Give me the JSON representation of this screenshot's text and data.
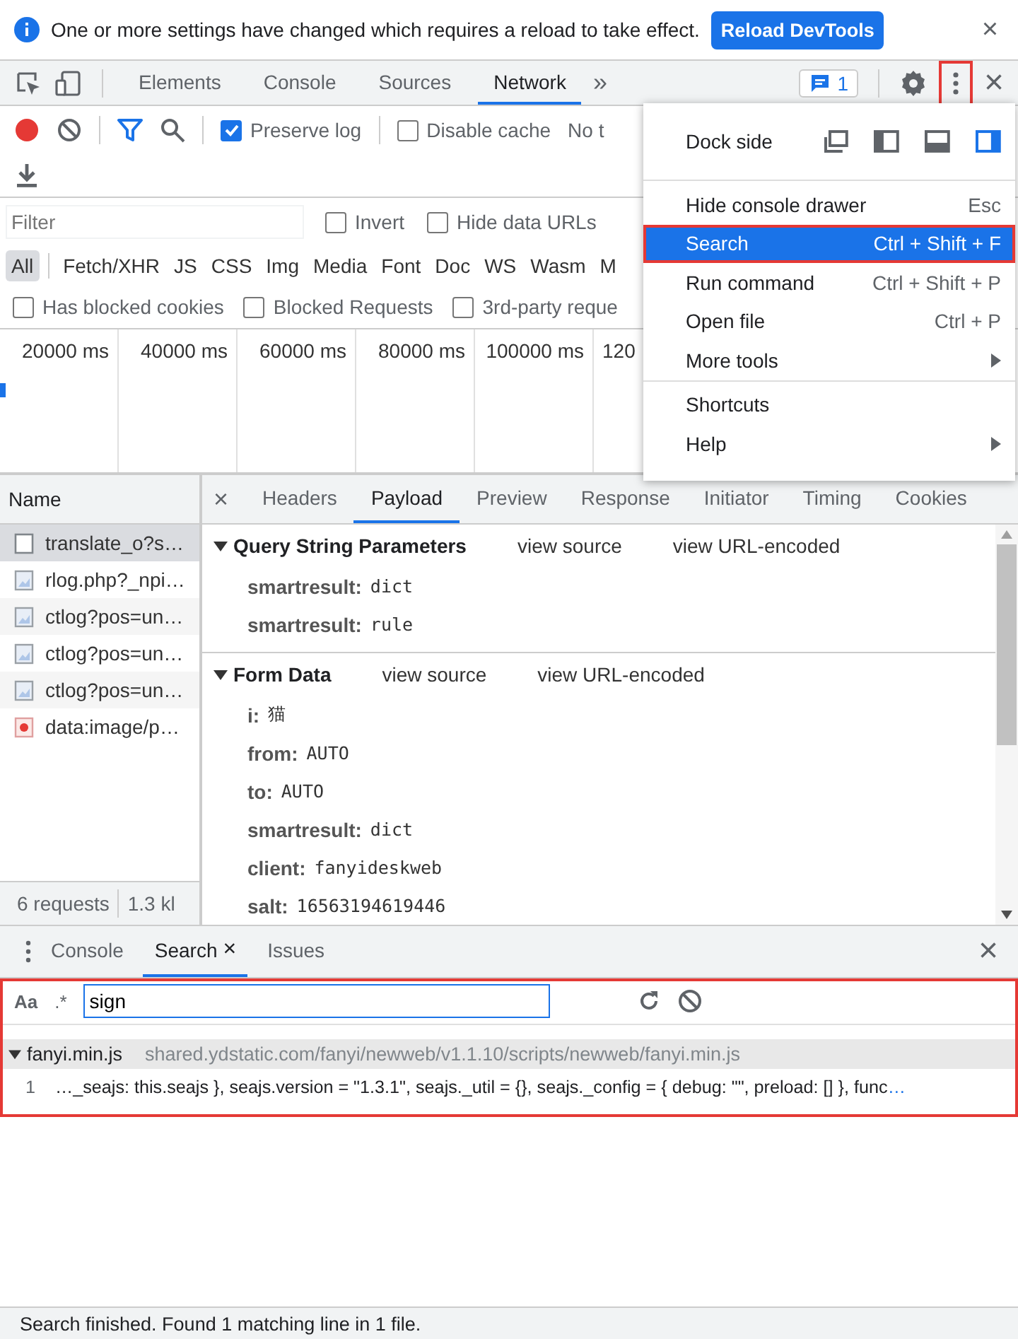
{
  "infobar": {
    "message": "One or more settings have changed which requires a reload to take effect.",
    "button": "Reload DevTools",
    "close": "×"
  },
  "main_tabs": [
    {
      "label": "Elements",
      "selected": false
    },
    {
      "label": "Console",
      "selected": false
    },
    {
      "label": "Sources",
      "selected": false
    },
    {
      "label": "Network",
      "selected": true
    }
  ],
  "tabs_overflow": "»",
  "issues_badge": "1",
  "more_button": {
    "highlighted": true
  },
  "main_close": "×",
  "toolbar": {
    "preserve_log": {
      "label": "Preserve log",
      "checked": true
    },
    "disable_cache": {
      "label": "Disable cache",
      "checked": false
    },
    "throttling": "No t"
  },
  "filter": {
    "placeholder": "Filter",
    "options": [
      {
        "label": "Invert",
        "checked": false
      },
      {
        "label": "Hide data URLs",
        "checked": false
      }
    ]
  },
  "types": [
    {
      "label": "All",
      "selected": true
    },
    {
      "label": "Fetch/XHR",
      "selected": false
    },
    {
      "label": "JS",
      "selected": false
    },
    {
      "label": "CSS",
      "selected": false
    },
    {
      "label": "Img",
      "selected": false
    },
    {
      "label": "Media",
      "selected": false
    },
    {
      "label": "Font",
      "selected": false
    },
    {
      "label": "Doc",
      "selected": false
    },
    {
      "label": "WS",
      "selected": false
    },
    {
      "label": "Wasm",
      "selected": false
    },
    {
      "label": "M",
      "selected": false
    }
  ],
  "blocked": [
    {
      "label": "Has blocked cookies",
      "checked": false
    },
    {
      "label": "Blocked Requests",
      "checked": false
    },
    {
      "label": "3rd-party reque",
      "checked": false
    }
  ],
  "timeline": {
    "ticks": [
      "20000 ms",
      "40000 ms",
      "60000 ms",
      "80000 ms",
      "100000 ms",
      "120"
    ]
  },
  "requests": {
    "header": "Name",
    "rows": [
      {
        "name": "translate_o?s…",
        "kind": "doc",
        "selected": true
      },
      {
        "name": "rlog.php?_npi…",
        "kind": "image",
        "selected": false
      },
      {
        "name": "ctlog?pos=un…",
        "kind": "image",
        "selected": false
      },
      {
        "name": "ctlog?pos=un…",
        "kind": "image",
        "selected": false
      },
      {
        "name": "ctlog?pos=un…",
        "kind": "image",
        "selected": false
      },
      {
        "name": "data:image/p…",
        "kind": "data",
        "selected": false
      }
    ],
    "summary": [
      "6 requests",
      "1.3 kl"
    ]
  },
  "detail": {
    "close": "×",
    "tabs": [
      {
        "label": "Headers",
        "selected": false
      },
      {
        "label": "Payload",
        "selected": true
      },
      {
        "label": "Preview",
        "selected": false
      },
      {
        "label": "Response",
        "selected": false
      },
      {
        "label": "Initiator",
        "selected": false
      },
      {
        "label": "Timing",
        "selected": false
      },
      {
        "label": "Cookies",
        "selected": false
      }
    ],
    "sections": [
      {
        "title": "Query String Parameters",
        "expanded": true,
        "links": [
          "view source",
          "view URL-encoded"
        ],
        "params": [
          {
            "key": "smartresult:",
            "value": "dict"
          },
          {
            "key": "smartresult:",
            "value": "rule"
          }
        ]
      },
      {
        "title": "Form Data",
        "expanded": true,
        "links": [
          "view source",
          "view URL-encoded"
        ],
        "params": [
          {
            "key": "i:",
            "value": "猫"
          },
          {
            "key": "from:",
            "value": "AUTO"
          },
          {
            "key": "to:",
            "value": "AUTO"
          },
          {
            "key": "smartresult:",
            "value": "dict"
          },
          {
            "key": "client:",
            "value": "fanyideskweb"
          },
          {
            "key": "salt:",
            "value": "16563194619446"
          }
        ]
      }
    ]
  },
  "menu": {
    "dock_label": "Dock side",
    "dock_options": [
      {
        "kind": "undock",
        "selected": false
      },
      {
        "kind": "left",
        "selected": false
      },
      {
        "kind": "bottom",
        "selected": false
      },
      {
        "kind": "right",
        "selected": true
      }
    ],
    "groups": [
      [
        {
          "label": "Hide console drawer",
          "shortcut": "Esc",
          "submenu": false,
          "selected": false,
          "highlighted": false
        },
        {
          "label": "Search",
          "shortcut": "Ctrl + Shift + F",
          "submenu": false,
          "selected": true,
          "highlighted": true
        },
        {
          "label": "Run command",
          "shortcut": "Ctrl + Shift + P",
          "submenu": false,
          "selected": false,
          "highlighted": false
        },
        {
          "label": "Open file",
          "shortcut": "Ctrl + P",
          "submenu": false,
          "selected": false,
          "highlighted": false
        },
        {
          "label": "More tools",
          "submenu": true,
          "selected": false,
          "highlighted": false
        }
      ],
      [
        {
          "label": "Shortcuts",
          "submenu": false,
          "selected": false,
          "highlighted": false
        },
        {
          "label": "Help",
          "submenu": true,
          "selected": false,
          "highlighted": false
        }
      ]
    ]
  },
  "drawer": {
    "tabs": [
      {
        "label": "Console",
        "selected": false
      },
      {
        "label": "Search",
        "selected": true,
        "close": "×"
      },
      {
        "label": "Issues",
        "selected": false
      }
    ],
    "close": "×"
  },
  "search": {
    "highlighted": true,
    "case_toggle": "Aa",
    "regex_toggle": ".*",
    "query": "sign",
    "results": [
      {
        "file": "fanyi.min.js",
        "path": "shared.ydstatic.com/fanyi/newweb/v1.1.10/scripts/newweb/fanyi.min.js",
        "expanded": true,
        "lines": [
          {
            "number": "1",
            "text": "…_seajs: this.seajs }, seajs.version = \"1.3.1\", seajs._util = {}, seajs._config = { debug: \"\", preload: [] }, func",
            "more": "…"
          }
        ]
      }
    ]
  },
  "status": "Search finished.  Found 1 matching line in 1 file."
}
